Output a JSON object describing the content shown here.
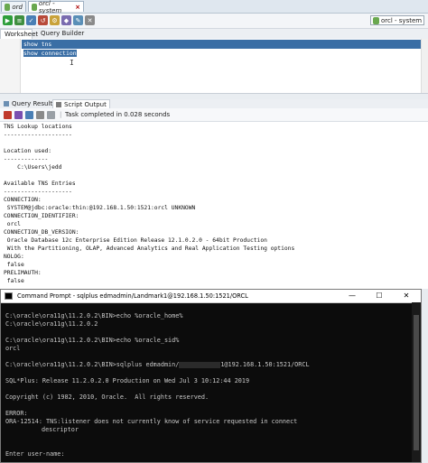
{
  "doc_tabs": [
    {
      "label": "ord",
      "active": false
    },
    {
      "label": "orcl - system",
      "active": true
    }
  ],
  "connection_selector": {
    "value": "orcl - system"
  },
  "worksheet_tabs": [
    {
      "label": "Worksheet"
    },
    {
      "label": "Query Builder"
    }
  ],
  "editor": {
    "lines": [
      "show tns",
      "show connection"
    ]
  },
  "result_tabs": [
    {
      "label": "Query Result"
    },
    {
      "label": "Script Output"
    }
  ],
  "script_status": "Task completed in 0.028 seconds",
  "output_lines": [
    "TNS Lookup locations",
    "--------------------",
    "",
    "Location used:",
    "-------------",
    "    C:\\Users\\jedd",
    "",
    "Available TNS Entries",
    "--------------------",
    "CONNECTION:",
    " SYSTEM@jdbc:oracle:thin:@192.168.1.50:1521:orcl UNKNOWN",
    "CONNECTION_IDENTIFIER:",
    " orcl",
    "CONNECTION_DB_VERSION:",
    " Oracle Database 12c Enterprise Edition Release 12.1.0.2.0 - 64bit Production",
    " With the Partitioning, OLAP, Advanced Analytics and Real Application Testing options",
    "NOLOG:",
    " false",
    "PRELIMAUTH:",
    " false"
  ],
  "cmd": {
    "title": "Command Prompt - sqlplus  edmadmin/Landmark1@192.168.1.50:1521/ORCL",
    "buttons": {
      "minimize": "—",
      "maximize": "☐",
      "close": "✕"
    },
    "lines": [
      "",
      "C:\\oracle\\ora11g\\11.2.0.2\\BIN>echo %oracle_home%",
      "C:\\oracle\\ora11g\\11.2.0.2",
      "",
      "C:\\oracle\\ora11g\\11.2.0.2\\BIN>echo %oracle_sid%",
      "orcl",
      "",
      "",
      "",
      "SQL*Plus: Release 11.2.0.2.0 Production on Wed Jul 3 10:12:44 2019",
      "",
      "Copyright (c) 1982, 2010, Oracle.  All rights reserved.",
      "",
      "ERROR:",
      "ORA-12514: TNS:listener does not currently know of service requested in connect",
      "descriptor",
      "",
      "",
      "Enter user-name:"
    ],
    "sqlplus_cmd_prefix": "C:\\oracle\\ora11g\\11.2.0.2\\BIN>sqlplus edmadmin/",
    "sqlplus_cmd_suffix": "1@192.168.1.50:1521/ORCL"
  },
  "colors": {
    "selection": "#3a6ea5",
    "cmd_bg": "#0c0c0c",
    "cmd_text": "#c8c8c8"
  }
}
